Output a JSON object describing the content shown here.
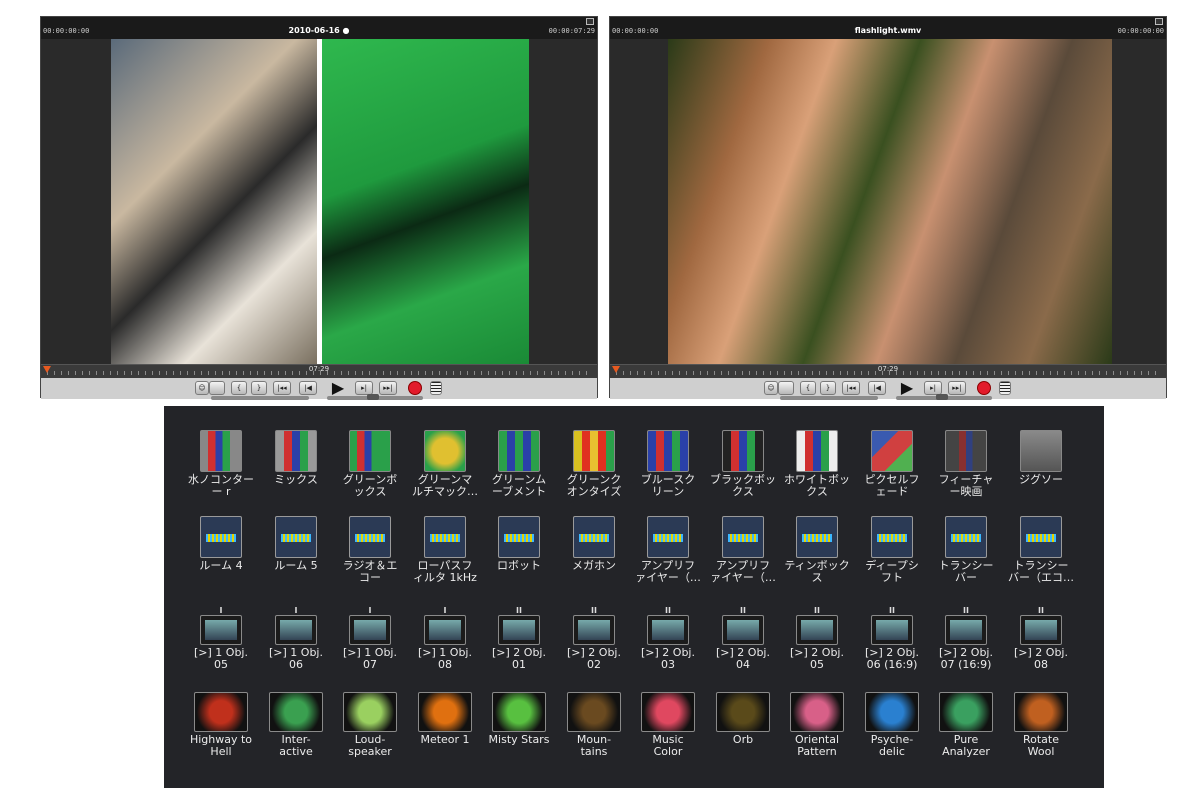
{
  "player_left": {
    "time_start": "00:00:00:00",
    "time_end": "00:00:07:29",
    "title": "2010-06-16 ●",
    "timeline_code": "07:29"
  },
  "player_right": {
    "time_start": "00:00:00:00",
    "time_end": "00:00:00:00",
    "title": "flashlight.wmv",
    "timeline_code": "07:29"
  },
  "colors": {
    "accent": "#e85a20",
    "record": "#e21b2b",
    "panel_bg": "#232428"
  },
  "effects_row1": [
    {
      "label": "水ノコンター\nー r",
      "icon": "filter-icon"
    },
    {
      "label": "ミックス",
      "icon": "filter-icon"
    },
    {
      "label": "グリーンボ\nックス",
      "icon": "filter-icon"
    },
    {
      "label": "グリーンマ\nルチマック…",
      "icon": "filter-icon"
    },
    {
      "label": "グリーンム\nーブメント",
      "icon": "filter-icon"
    },
    {
      "label": "グリーンク\nオンタイズ",
      "icon": "filter-icon"
    },
    {
      "label": "ブルースク\nリーン",
      "icon": "filter-icon"
    },
    {
      "label": "ブラックボッ\nクス",
      "icon": "filter-icon"
    },
    {
      "label": "ホワイトボッ\nクス",
      "icon": "filter-icon"
    },
    {
      "label": "ピクセルフ\nェード",
      "icon": "filter-icon"
    },
    {
      "label": "フィーチャ\nー映画",
      "icon": "filter-icon"
    },
    {
      "label": "ジグソー",
      "icon": "puzzle-icon"
    }
  ],
  "effects_row2": [
    {
      "label": "ルーム 4"
    },
    {
      "label": "ルーム 5"
    },
    {
      "label": "ラジオ＆エ\nコー"
    },
    {
      "label": "ローパスフ\nィルタ 1kHz"
    },
    {
      "label": "ロボット"
    },
    {
      "label": "メガホン"
    },
    {
      "label": "アンプリフ\nァイヤー（…"
    },
    {
      "label": "アンプリフ\nァイヤー（…"
    },
    {
      "label": "ティンボック\nス"
    },
    {
      "label": "ディープシ\nフト"
    },
    {
      "label": "トランシー\nバー"
    },
    {
      "label": "トランシー\nバー（エコ…"
    }
  ],
  "effects_row3": [
    {
      "num": "I",
      "label": "[>] 1 Obj.\n05"
    },
    {
      "num": "I",
      "label": "[>] 1 Obj.\n06"
    },
    {
      "num": "I",
      "label": "[>] 1 Obj.\n07"
    },
    {
      "num": "I",
      "label": "[>] 1 Obj.\n08"
    },
    {
      "num": "II",
      "label": "[>] 2 Obj.\n01"
    },
    {
      "num": "II",
      "label": "[>] 2 Obj.\n02"
    },
    {
      "num": "II",
      "label": "[>] 2 Obj.\n03"
    },
    {
      "num": "II",
      "label": "[>] 2 Obj.\n04"
    },
    {
      "num": "II",
      "label": "[>] 2 Obj.\n05"
    },
    {
      "num": "II",
      "label": "[>] 2 Obj.\n06 (16:9)"
    },
    {
      "num": "II",
      "label": "[>] 2 Obj.\n07 (16:9)"
    },
    {
      "num": "II",
      "label": "[>] 2 Obj.\n08"
    }
  ],
  "effects_row4": [
    {
      "label": "Highway to\nHell",
      "color": "#c0301c"
    },
    {
      "label": "Inter-\nactive",
      "color": "#3aa050"
    },
    {
      "label": "Loud-\nspeaker",
      "color": "#9ad060"
    },
    {
      "label": "Meteor 1",
      "color": "#e07010"
    },
    {
      "label": "Misty Stars",
      "color": "#58c040"
    },
    {
      "label": "Moun-\ntains",
      "color": "#6a4a20"
    },
    {
      "label": "Music\nColor",
      "color": "#e04860"
    },
    {
      "label": "Orb",
      "color": "#5a4a1a"
    },
    {
      "label": "Oriental\nPattern",
      "color": "#d86088"
    },
    {
      "label": "Psyche-\ndelic",
      "color": "#2a80d0"
    },
    {
      "label": "Pure\nAnalyzer",
      "color": "#3aa060"
    },
    {
      "label": "Rotate\nWool",
      "color": "#c06020"
    }
  ]
}
